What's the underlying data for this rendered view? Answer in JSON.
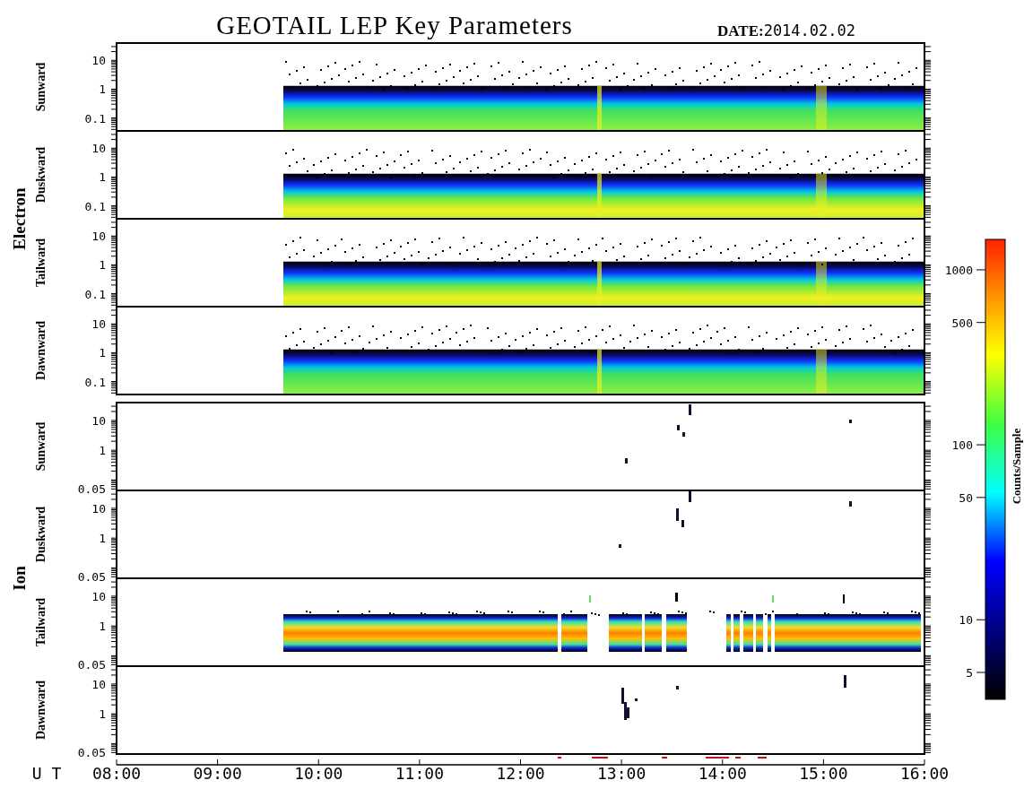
{
  "title": "GEOTAIL LEP Key Parameters",
  "date": {
    "label": "DATE:",
    "value": "2014.02.02"
  },
  "groups": [
    {
      "label": "Electron",
      "panels": [
        {
          "label": "Sunward",
          "kind": "electron-spectrum",
          "yticks": [
            "10",
            "1",
            "0.1"
          ]
        },
        {
          "label": "Duskward",
          "kind": "electron-spectrum-bright",
          "yticks": [
            "10",
            "1",
            "0.1"
          ]
        },
        {
          "label": "Tailward",
          "kind": "electron-spectrum-bright",
          "yticks": [
            "10",
            "1",
            "0.1"
          ]
        },
        {
          "label": "Dawnward",
          "kind": "electron-spectrum",
          "yticks": [
            "10",
            "1",
            "0.1"
          ]
        }
      ]
    },
    {
      "label": "Ion",
      "panels": [
        {
          "label": "Sunward",
          "kind": "sparse",
          "yticks": [
            "10",
            "1",
            "0.05"
          ]
        },
        {
          "label": "Duskward",
          "kind": "sparse",
          "yticks": [
            "10",
            "1",
            "0.05"
          ]
        },
        {
          "label": "Tailward",
          "kind": "ion-spectrum",
          "yticks": [
            "10",
            "1",
            "0.05"
          ]
        },
        {
          "label": "Dawnward",
          "kind": "sparse",
          "yticks": [
            "10",
            "1",
            "0.05"
          ]
        }
      ]
    }
  ],
  "time_axis": {
    "label": "U T",
    "ticks": [
      "08:00",
      "09:00",
      "10:00",
      "11:00",
      "12:00",
      "13:00",
      "14:00",
      "15:00",
      "16:00"
    ]
  },
  "colorbar": {
    "label": "Counts/Sample",
    "ticks": [
      "1000",
      "500",
      "100",
      "50",
      "10",
      "5"
    ]
  }
}
